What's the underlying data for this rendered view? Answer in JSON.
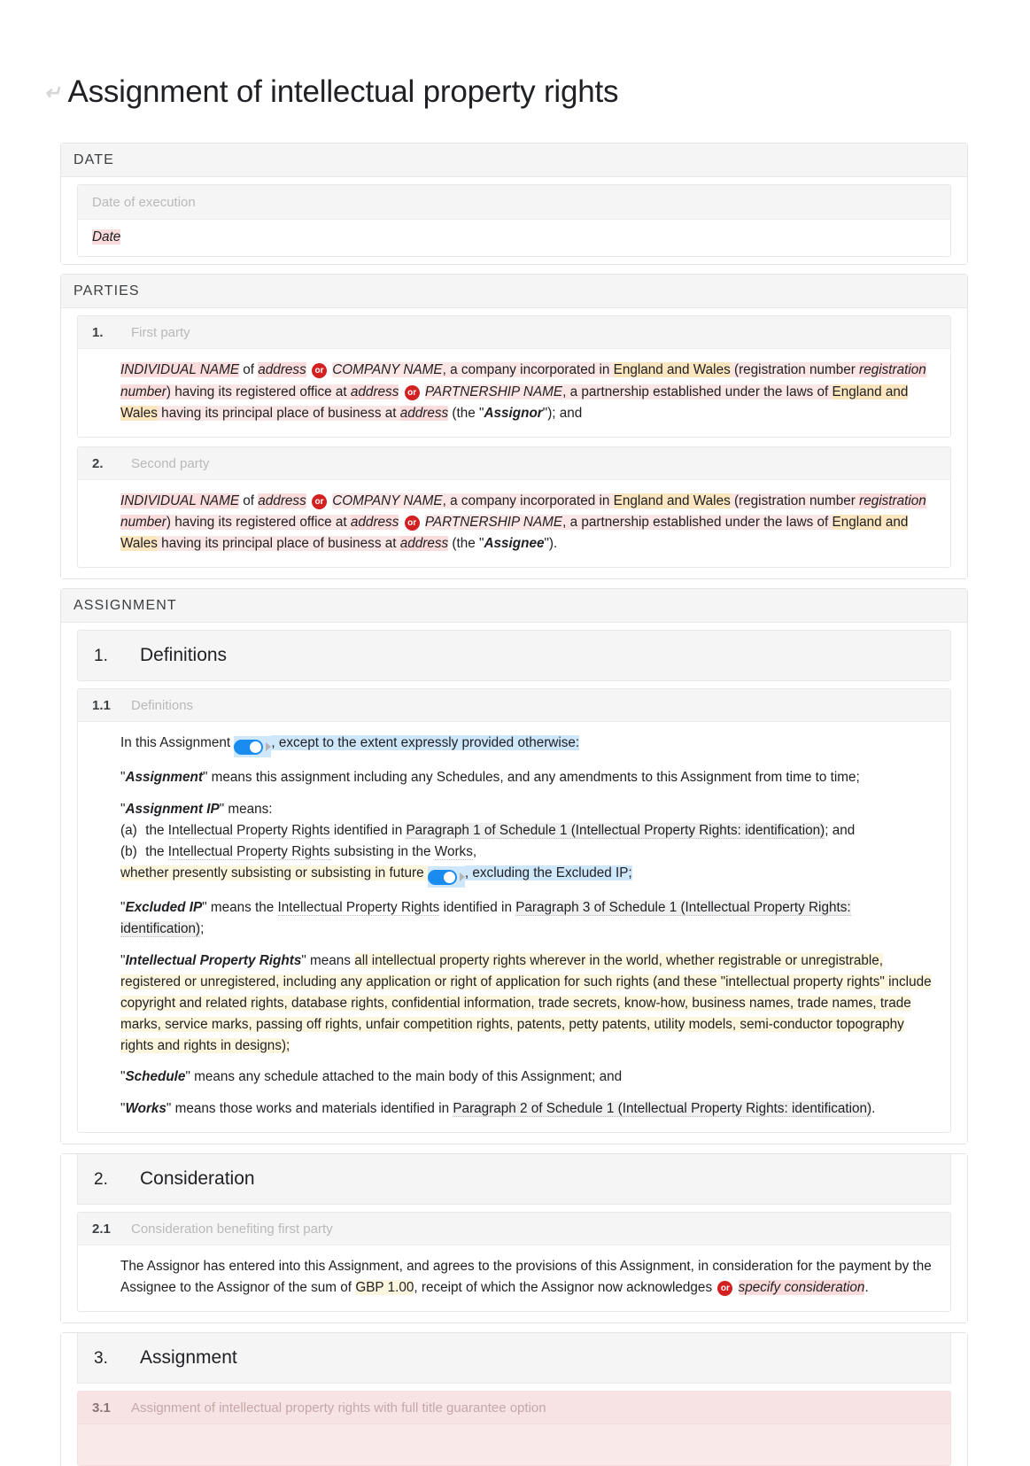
{
  "document": {
    "glyph_icon": "document-mark-icon",
    "title": "Assignment of intellectual property rights"
  },
  "colors": {
    "accent_toggle": "#1a8cf0",
    "or_badge": "#d32020",
    "highlight_pink": "#fadcdc",
    "highlight_yellow": "#fbe6bf",
    "highlight_blue": "#cfe7fb",
    "highlight_grey": "#efefef",
    "section_header_bg": "#f5f5f5",
    "clause_pink_bg": "#fae9e9"
  },
  "sections": [
    {
      "heading": "DATE",
      "field": {
        "label": "Date of execution",
        "value": "Date"
      }
    },
    {
      "heading": "PARTIES",
      "parties": [
        {
          "num": "1.",
          "label": "First party",
          "individual_name": "INDIVIDUAL NAME",
          "of": " of ",
          "address1": "address",
          "or": "or",
          "company_name": "COMPANY NAME",
          "incorporated": ", a company incorporated in ",
          "jurisdiction1": "England and Wales",
          "reg_open": " (registration number ",
          "registration_number": "registration number",
          "reg_close": ") having its registered office at ",
          "address2": "address",
          "partnership_name": "PARTNERSHIP NAME",
          "partnership_text": ", a partnership established under the laws of ",
          "jurisdiction2": "England and Wales",
          "principal": " having its principal place of business at ",
          "address3": "address",
          "the_open": " (the \"",
          "defined_role": "Assignor",
          "the_close": "\"); and"
        },
        {
          "num": "2.",
          "label": "Second party",
          "individual_name": "INDIVIDUAL NAME",
          "of": " of ",
          "address1": "address",
          "or": "or",
          "company_name": "COMPANY NAME",
          "incorporated": ", a company incorporated in ",
          "jurisdiction1": "England and Wales",
          "reg_open": " (registration number ",
          "registration_number": "registration number",
          "reg_close": ") having its registered office at ",
          "address2": "address",
          "partnership_name": "PARTNERSHIP NAME",
          "partnership_text": ", a partnership established under the laws of ",
          "jurisdiction2": "England and Wales",
          "principal": " having its principal place of business at ",
          "address3": "address",
          "the_open": " (the \"",
          "defined_role": "Assignee",
          "the_close": "\")."
        }
      ]
    },
    {
      "heading": "ASSIGNMENT"
    }
  ],
  "assignment": {
    "clause1": {
      "num": "1.",
      "title": "Definitions",
      "sub_num": "1.1",
      "sub_label": "Definitions",
      "intro_a": "In this Assignment ",
      "intro_toggle": "toggle-on",
      "intro_b": ", except to the extent expressly provided otherwise:",
      "def_assignment": {
        "term": "Assignment",
        "body": "\" means this assignment including any Schedules, and any amendments to this Assignment from time to time;"
      },
      "def_assignment_ip": {
        "term": "Assignment IP",
        "means": "\" means:",
        "item_a_letter": "(a)",
        "item_a_pre": " the ",
        "item_a_term": "Intellectual Property Rights",
        "item_a_mid": " identified in ",
        "item_a_ref": "Paragraph 1 of Schedule 1 (Intellectual Property Rights: identification)",
        "item_a_post": "; and",
        "item_b_letter": "(b)",
        "item_b_pre": " the ",
        "item_b_term": "Intellectual Property Rights",
        "item_b_mid": " subsisting in the ",
        "item_b_term2": "Works",
        "item_b_post": ",",
        "tail_yellow": "whether presently subsisting or subsisting in future ",
        "tail_toggle": "toggle-on",
        "tail_blue": ", excluding the Excluded IP;"
      },
      "def_excluded_ip": {
        "term": "Excluded IP",
        "pre": "\" means the ",
        "dotted_term": "Intellectual Property Rights",
        "mid": " identified in ",
        "ref": "Paragraph 3 of Schedule 1 (Intellectual Property Rights: identification)",
        "post": ";"
      },
      "def_ipr": {
        "term": "Intellectual Property Rights",
        "means": "\" means ",
        "body": "all intellectual property rights wherever in the world, whether registrable or unregistrable, registered or unregistered, including any application or right of application for such rights (and these \"intellectual property rights\" include copyright and related rights, database rights, confidential information, trade secrets, know-how, business names, trade names, trade marks, service marks, passing off rights, unfair competition rights, patents, petty patents, utility models, semi-conductor topography rights and rights in designs);"
      },
      "def_schedule": {
        "term": "Schedule",
        "body": "\" means any schedule attached to the main body of this Assignment; and"
      },
      "def_works": {
        "term": "Works",
        "pre": "\" means those works and materials identified in ",
        "ref": "Paragraph 2 of Schedule 1 (Intellectual Property Rights: identification)",
        "post": "."
      }
    },
    "clause2": {
      "num": "2.",
      "title": "Consideration",
      "sub_num": "2.1",
      "sub_label": "Consideration benefiting first party",
      "text_a": "The Assignor has entered into this Assignment, and agrees to the provisions of this Assignment, in consideration for the payment by the Assignee to the Assignor of the sum of ",
      "amount": "GBP 1.00",
      "text_b": ", receipt of which the Assignor now acknowledges ",
      "or": "or",
      "alt_text": "specify consideration",
      "text_c": "."
    },
    "clause3": {
      "num": "3.",
      "title": "Assignment",
      "sub_num": "3.1",
      "sub_label": "Assignment of intellectual property rights with full title guarantee option"
    }
  }
}
